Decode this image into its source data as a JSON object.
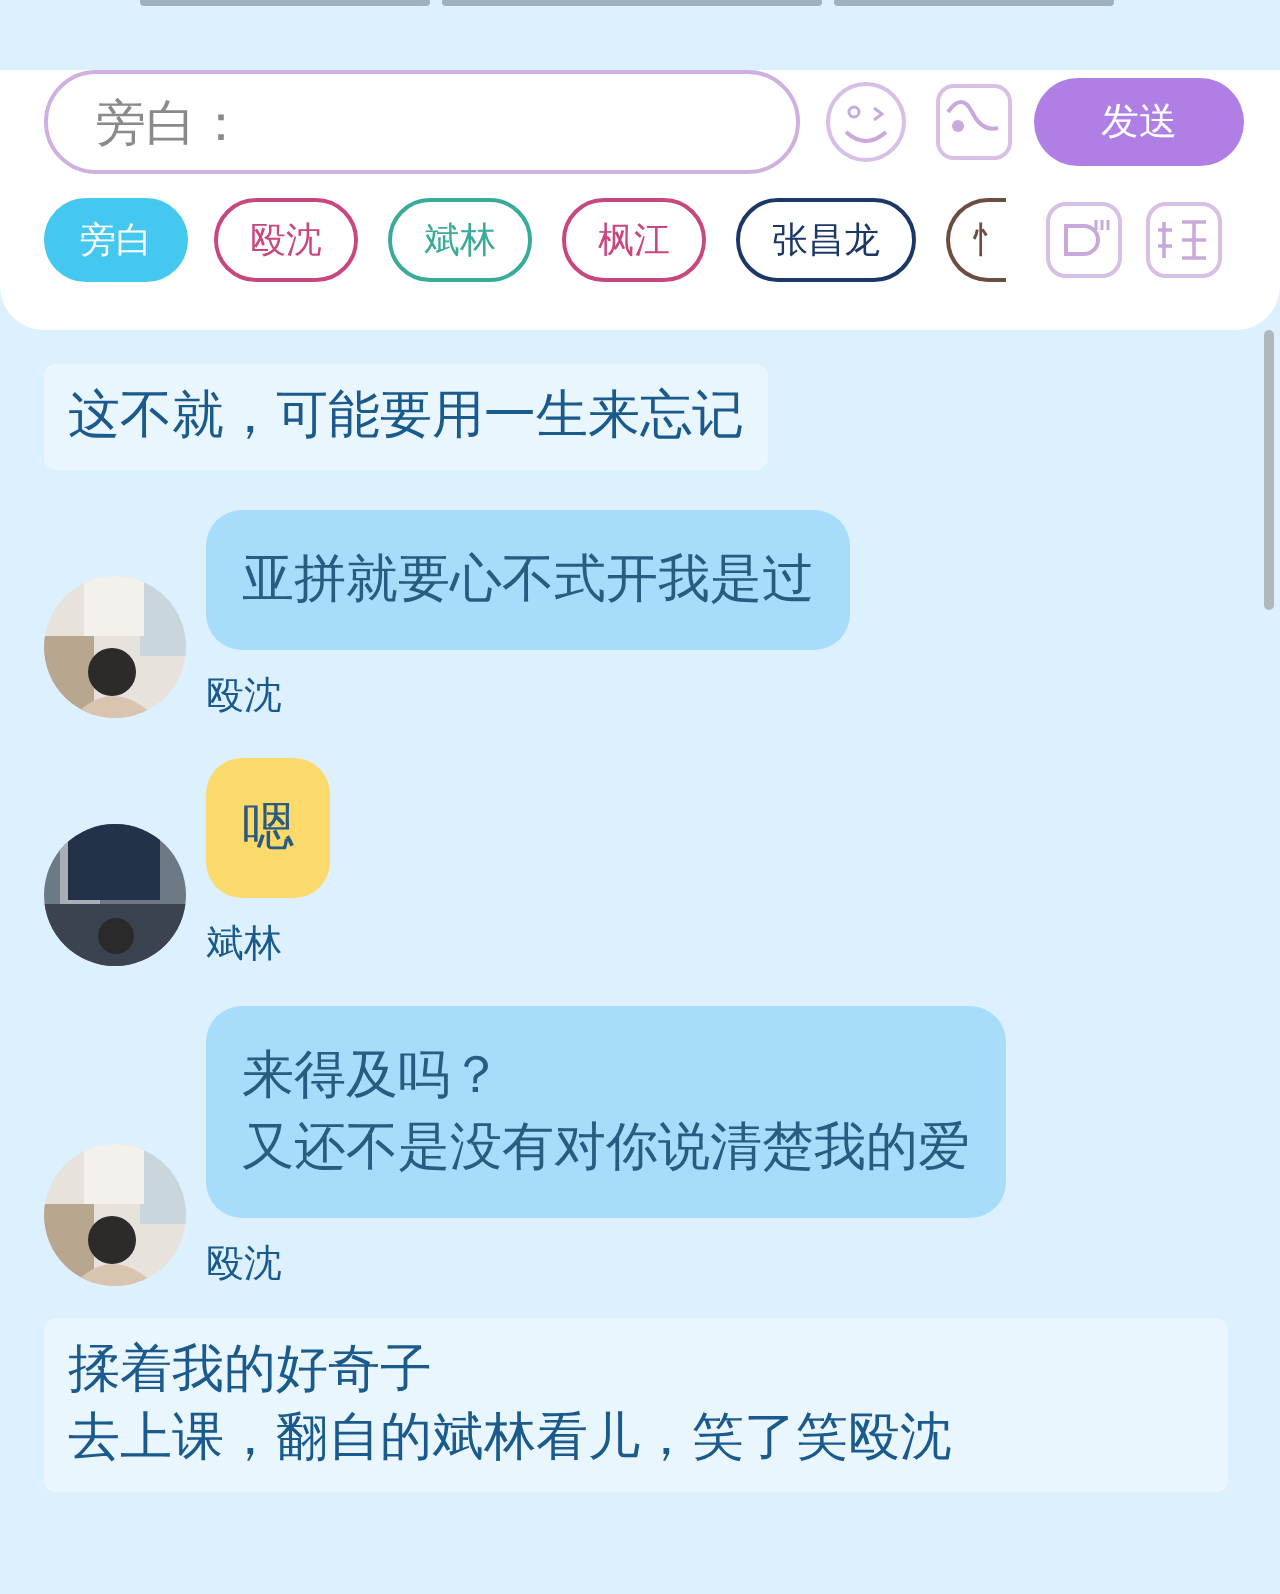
{
  "composer": {
    "placeholder": "旁白：",
    "send_button": "发送"
  },
  "speakers": [
    {
      "label": "旁白",
      "color": "#45c8ef",
      "selected": true
    },
    {
      "label": "殴沈",
      "color": "#c9477f",
      "selected": false
    },
    {
      "label": "斌林",
      "color": "#3aab9a",
      "selected": false
    },
    {
      "label": "枫江",
      "color": "#c9477f",
      "selected": false
    },
    {
      "label": "张昌龙",
      "color": "#1b3767",
      "selected": false
    },
    {
      "label": "忄",
      "color": "#6d4c41",
      "selected": false
    }
  ],
  "messages": [
    {
      "kind": "narration",
      "lines": [
        "这不就，可能要用一生来忘记"
      ]
    },
    {
      "kind": "bubble",
      "name": "殴沈",
      "color": "#a8dcfb",
      "lines": [
        "亚拼就要心不式开我是过"
      ]
    },
    {
      "kind": "bubble",
      "name": "斌林",
      "color": "#fcd96b",
      "lines": [
        "嗯"
      ]
    },
    {
      "kind": "bubble",
      "name": "殴沈",
      "color": "#a8dcfb",
      "lines": [
        "来得及吗？",
        "又还不是没有对你说清楚我的爱"
      ]
    },
    {
      "kind": "narration",
      "lines": [
        "揉着我的好奇子",
        "去上课，翻自的斌林看儿，笑了笑殴沈"
      ]
    }
  ]
}
